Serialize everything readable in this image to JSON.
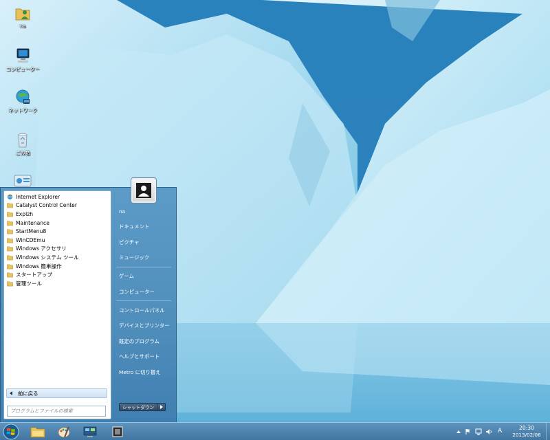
{
  "desktop": {
    "icons": [
      {
        "label": "na",
        "icon": "user-folder-icon"
      },
      {
        "label": "コンピューター",
        "icon": "computer-icon"
      },
      {
        "label": "ネットワーク",
        "icon": "network-icon"
      },
      {
        "label": "ごみ箱",
        "icon": "recycle-bin-icon"
      }
    ]
  },
  "start_menu": {
    "programs": [
      {
        "label": "Internet Explorer",
        "icon": "ie-icon"
      },
      {
        "label": "Catalyst Control Center",
        "icon": "folder-icon"
      },
      {
        "label": "Explzh",
        "icon": "folder-icon"
      },
      {
        "label": "Maintenance",
        "icon": "folder-icon"
      },
      {
        "label": "StartMenu8",
        "icon": "folder-icon"
      },
      {
        "label": "WinCDEmu",
        "icon": "folder-icon"
      },
      {
        "label": "Windows アクセサリ",
        "icon": "folder-icon"
      },
      {
        "label": "Windows システム ツール",
        "icon": "folder-icon"
      },
      {
        "label": "Windows 簡単操作",
        "icon": "folder-icon"
      },
      {
        "label": "スタートアップ",
        "icon": "folder-icon"
      },
      {
        "label": "管理ツール",
        "icon": "folder-icon"
      }
    ],
    "back_label": "前に戻る",
    "search_placeholder": "プログラムとファイルの検索",
    "right": {
      "user": "na",
      "documents": "ドキュメント",
      "pictures": "ピクチャ",
      "music": "ミュージック",
      "games": "ゲーム",
      "computer": "コンピューター",
      "control_panel": "コントロールパネル",
      "devices": "デバイスとプリンター",
      "default_programs": "既定のプログラム",
      "help": "ヘルプとサポート",
      "metro": "Metro に切り替え"
    },
    "shutdown_label": "シャットダウン"
  },
  "taskbar": {
    "pinned": [
      "explorer-icon",
      "paint-icon",
      "control-panel-icon",
      "app-icon"
    ],
    "tray": {
      "ime": "A",
      "time": "20:30",
      "date": "2013/02/06"
    }
  },
  "colors": {
    "menu_blue": "#4f8dbb",
    "taskbar_blue": "#4a7ba8",
    "ice": "#bfe6f4"
  }
}
